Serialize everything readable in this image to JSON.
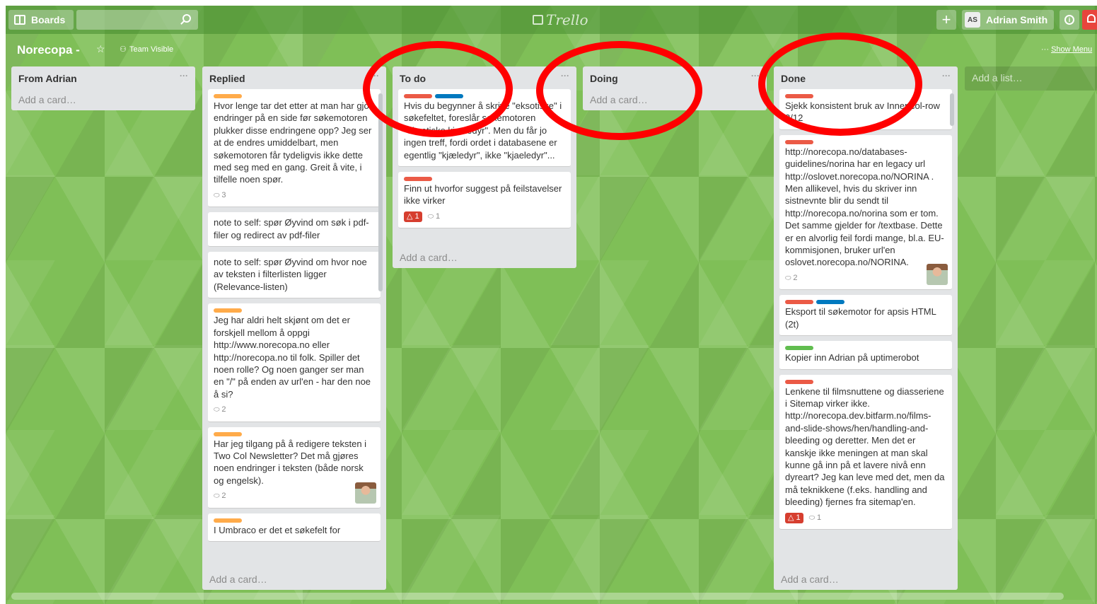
{
  "header": {
    "boards_label": "Boards",
    "search_value": "",
    "logo_text": "Trello",
    "add_icon": "plus-icon",
    "member_initials": "AS",
    "member_name": "Adrian Smith",
    "info_icon": "info-icon",
    "notification_icon": "bell-icon"
  },
  "board": {
    "title": "Norecopa -",
    "visibility": "Team Visible",
    "menu_dots": "···",
    "show_menu": "Show Menu"
  },
  "colors": {
    "background": "#7fbf57",
    "label_orange": "#ffab4a",
    "label_red": "#eb5a46",
    "label_blue": "#0079bf",
    "label_green": "#61bd4f",
    "annotation": "#ff0000"
  },
  "add_card": "Add a card…",
  "add_list": "Add a list…",
  "lists": [
    {
      "title": "From Adrian",
      "menu": "···",
      "cards": []
    },
    {
      "title": "Replied",
      "menu": "···",
      "cards": [
        {
          "labels": [
            "orange"
          ],
          "text": "Hvor lenge tar det etter at man har gjort endringer på en side før søkemotoren plukker disse endringene opp? Jeg ser at de endres umiddelbart, men søkemotoren får tydeligvis ikke dette med seg med en gang. Greit å vite, i tilfelle noen spør.",
          "comments": "3"
        },
        {
          "labels": [],
          "text": "note to self: spør Øyvind om søk i pdf-filer og redirect av pdf-filer"
        },
        {
          "labels": [],
          "text": "note to self: spør Øyvind om hvor noe av teksten i filterlisten ligger (Relevance-listen)"
        },
        {
          "labels": [
            "orange"
          ],
          "text": "Jeg har aldri helt skjønt om det er forskjell mellom å oppgi http://www.norecopa.no eller http://norecopa.no til folk. Spiller det noen rolle? Og noen ganger ser man en \"/\" på enden av url'en - har den noe å si?",
          "comments": "2"
        },
        {
          "labels": [
            "orange"
          ],
          "text": "Har jeg tilgang på å redigere teksten i Two Col Newsletter? Det må gjøres noen endringer i teksten (både norsk og engelsk).",
          "comments": "2",
          "avatar": true
        },
        {
          "labels": [
            "orange"
          ],
          "text": "I Umbraco er det et søkefelt for"
        }
      ]
    },
    {
      "title": "To do",
      "menu": "···",
      "cards": [
        {
          "labels": [
            "red",
            "blue"
          ],
          "text": "Hvis du begynner å skrive \"eksotiske\" i søkefeltet, foreslår søkemotoren \"eksotiske kjaeledyr\". Men du får jo ingen treff, fordi ordet i databasene er egentlig \"kjæledyr\", ikke \"kjaeledyr\"..."
        },
        {
          "labels": [
            "red"
          ],
          "text": "Finn ut hvorfor suggest på feilstavelser ikke virker",
          "due": "1",
          "comments": "1"
        }
      ]
    },
    {
      "title": "Doing",
      "menu": "···",
      "cards": []
    },
    {
      "title": "Done",
      "menu": "···",
      "cards": [
        {
          "labels": [
            "red"
          ],
          "text": "Sjekk konsistent bruk av Inner col-row 3/12"
        },
        {
          "labels": [
            "red"
          ],
          "text": "http://norecopa.no/databases-guidelines/norina har en legacy url http://oslovet.norecopa.no/NORINA . Men allikevel, hvis du skriver inn sistnevnte blir du sendt til http://norecopa.no/norina som er tom. Det samme gjelder for /textbase. Dette er en alvorlig feil fordi mange, bl.a. EU-kommisjonen, bruker url'en oslovet.norecopa.no/NORINA.",
          "comments": "2",
          "avatar": true
        },
        {
          "labels": [
            "red",
            "blue"
          ],
          "text": "Eksport til søkemotor for apsis HTML (2t)"
        },
        {
          "labels": [
            "green"
          ],
          "text": "Kopier inn Adrian på uptimerobot"
        },
        {
          "labels": [
            "red"
          ],
          "text": "Lenkene til filmsnuttene og diasseriene i Sitemap virker ikke. http://norecopa.dev.bitfarm.no/films-and-slide-shows/hen/handling-and-bleeding og deretter. Men det er kanskje ikke meningen at man skal kunne gå inn på et lavere nivå enn dyreart? Jeg kan leve med det, men da må teknikkene (f.eks. handling and bleeding) fjernes fra sitemap'en.",
          "due": "1",
          "comments": "1"
        }
      ]
    }
  ]
}
